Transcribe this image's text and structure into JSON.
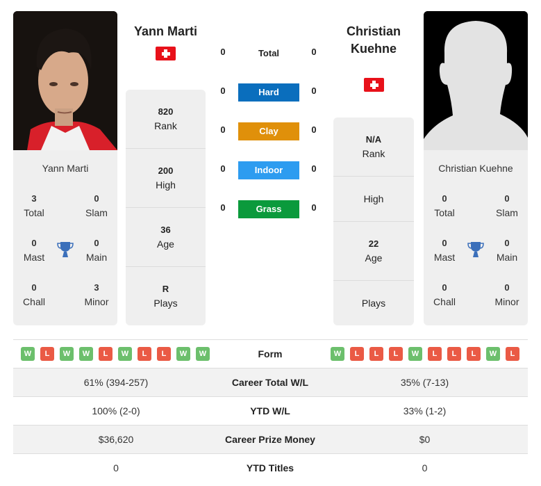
{
  "player1": {
    "name": "Yann Marti",
    "flag": "switzerland-flag",
    "photo": "player-photo",
    "card_name": "Yann Marti",
    "titles": {
      "total": {
        "value": "3",
        "label": "Total"
      },
      "slam": {
        "value": "0",
        "label": "Slam"
      },
      "mast": {
        "value": "0",
        "label": "Mast"
      },
      "main": {
        "value": "0",
        "label": "Main"
      },
      "chall": {
        "value": "0",
        "label": "Chall"
      },
      "minor": {
        "value": "3",
        "label": "Minor"
      }
    },
    "stats": {
      "rank": {
        "value": "820",
        "label": "Rank"
      },
      "high": {
        "value": "200",
        "label": "High"
      },
      "age": {
        "value": "36",
        "label": "Age"
      },
      "plays": {
        "value": "R",
        "label": "Plays"
      }
    },
    "form": [
      "W",
      "L",
      "W",
      "W",
      "L",
      "W",
      "L",
      "L",
      "W",
      "W"
    ]
  },
  "player2": {
    "name": "Christian Kuehne",
    "name_line1": "Christian",
    "name_line2": "Kuehne",
    "flag": "switzerland-flag",
    "photo": "silhouette-placeholder",
    "card_name": "Christian Kuehne",
    "titles": {
      "total": {
        "value": "0",
        "label": "Total"
      },
      "slam": {
        "value": "0",
        "label": "Slam"
      },
      "mast": {
        "value": "0",
        "label": "Mast"
      },
      "main": {
        "value": "0",
        "label": "Main"
      },
      "chall": {
        "value": "0",
        "label": "Chall"
      },
      "minor": {
        "value": "0",
        "label": "Minor"
      }
    },
    "stats": {
      "rank": {
        "value": "N/A",
        "label": "Rank"
      },
      "high": {
        "value": "",
        "label": "High"
      },
      "age": {
        "value": "22",
        "label": "Age"
      },
      "plays": {
        "value": "",
        "label": "Plays"
      }
    },
    "form": [
      "W",
      "L",
      "L",
      "L",
      "W",
      "L",
      "L",
      "L",
      "W",
      "L"
    ]
  },
  "h2h": {
    "total": {
      "label": "Total",
      "p1": "0",
      "p2": "0"
    },
    "surfaces": [
      {
        "label": "Hard",
        "p1": "0",
        "p2": "0",
        "color": "#0a6ebd"
      },
      {
        "label": "Clay",
        "p1": "0",
        "p2": "0",
        "color": "#e0900a"
      },
      {
        "label": "Indoor",
        "p1": "0",
        "p2": "0",
        "color": "#2d9cf0"
      },
      {
        "label": "Grass",
        "p1": "0",
        "p2": "0",
        "color": "#0b9a3c"
      }
    ]
  },
  "comparison": {
    "form_label": "Form",
    "rows": [
      {
        "label": "Career Total W/L",
        "p1": "61% (394-257)",
        "p2": "35% (7-13)"
      },
      {
        "label": "YTD W/L",
        "p1": "100% (2-0)",
        "p2": "33% (1-2)"
      },
      {
        "label": "Career Prize Money",
        "p1": "$36,620",
        "p2": "$0"
      },
      {
        "label": "YTD Titles",
        "p1": "0",
        "p2": "0"
      }
    ]
  },
  "colors": {
    "win": "#6cbf6c",
    "loss": "#ea5a45",
    "trophy": "#3b6fba",
    "card": "#efefef"
  }
}
